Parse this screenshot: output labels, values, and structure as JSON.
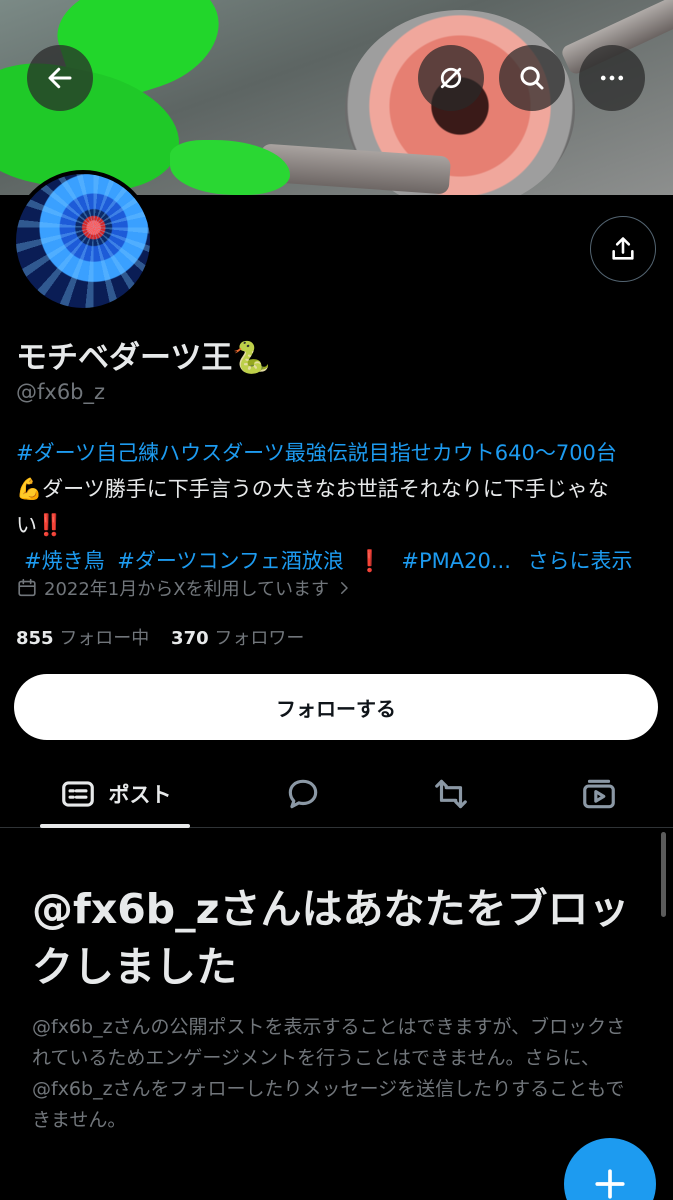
{
  "profile": {
    "name": "モチベダーツ王🐍",
    "handle": "@fx6b_z",
    "bio_line1": "#ダーツ自己練ハウスダーツ最強伝説目指せカウト640〜700台",
    "bio_line2": "💪ダーツ勝手に下手言うの大きなお世話それなりに下手じゃな",
    "bio_line3": "い‼️",
    "bio_tags": [
      "#焼き鳥",
      "#ダーツコンフェ酒放浪",
      "❗",
      "#PMA20..."
    ],
    "bio_more": "さらに表示",
    "joined": "2022年1月からXを利用しています",
    "following_count": "855",
    "following_label": "フォロー中",
    "followers_count": "370",
    "followers_label": "フォロワー"
  },
  "actions": {
    "follow_label": "フォローする"
  },
  "tabs": [
    {
      "label": "ポスト",
      "icon": "posts-icon",
      "active": true
    },
    {
      "label": "",
      "icon": "reply-icon",
      "active": false
    },
    {
      "label": "",
      "icon": "repost-icon",
      "active": false
    },
    {
      "label": "",
      "icon": "media-icon",
      "active": false
    }
  ],
  "blocked": {
    "title": "@fx6b_zさんはあなたをブロックしました",
    "body": "@fx6b_zさんの公開ポストを表示することはできますが、ブロックされているためエンゲージメントを行うことはできません。さらに、@fx6b_zさんをフォローしたりメッセージを送信したりすることもできません。"
  },
  "colors": {
    "accent": "#1d9bf0",
    "background": "#000000",
    "text": "#e7e9ea",
    "muted": "#71767b"
  }
}
